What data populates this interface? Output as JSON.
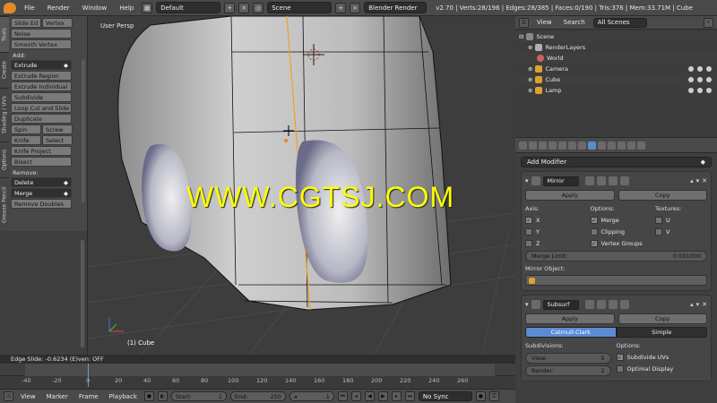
{
  "topbar": {
    "menus": [
      "File",
      "Render",
      "Window",
      "Help"
    ],
    "layout": "Default",
    "scene": "Scene",
    "engine": "Blender Render",
    "stats": "v2.70 | Verts:28/196 | Edges:28/385 | Faces:0/190 | Tris:376 | Mem:33.71M | Cube"
  },
  "tabs": [
    "Tools",
    "Create",
    "Shading / UVs",
    "Options",
    "Grease Pencil"
  ],
  "shelf": {
    "row1": [
      "Slide Ed",
      "Vertex"
    ],
    "noise": "Noise",
    "smooth_vertex": "Smooth Vertex",
    "add_label": "Add:",
    "extrude": "Extrude",
    "extrude_region": "Extrude Region",
    "extrude_individual": "Extrude Individual",
    "subdivide": "Subdivide",
    "loop_cut": "Loop Cut and Slide",
    "duplicate": "Duplicate",
    "spin": "Spin",
    "screw": "Screw",
    "knife": "Knife",
    "select": "Select",
    "knife_project": "Knife Project",
    "bisect": "Bisect",
    "remove_label": "Remove:",
    "delete": "Delete",
    "merge": "Merge",
    "remove_doubles": "Remove Doubles"
  },
  "viewport": {
    "label": "User Persp",
    "object": "(1) Cube",
    "watermark": "WWW.CGTSJ.COM"
  },
  "statusline": "Edge Slide: -0.6234 (E)ven: OFF",
  "timeline": {
    "ticks": [
      "-40",
      "-20",
      "0",
      "20",
      "40",
      "60",
      "80",
      "100",
      "120",
      "140",
      "160",
      "180",
      "200",
      "220",
      "240",
      "260"
    ]
  },
  "bottombar": {
    "menus": [
      "View",
      "Marker",
      "Frame",
      "Playback"
    ],
    "start_label": "Start:",
    "start": "1",
    "end_label": "End:",
    "end": "250",
    "current": "1",
    "sync": "No Sync"
  },
  "outliner": {
    "view": "View",
    "search": "Search",
    "filter": "All Scenes",
    "items": [
      {
        "name": "Scene",
        "color": "#8a8a8a"
      },
      {
        "name": "RenderLayers",
        "color": "#b0b0b0"
      },
      {
        "name": "World",
        "color": "#d06060"
      },
      {
        "name": "Camera",
        "color": "#e0a030"
      },
      {
        "name": "Cube",
        "color": "#e0a030"
      },
      {
        "name": "Lamp",
        "color": "#e0a030"
      }
    ]
  },
  "props": {
    "add_modifier": "Add Modifier",
    "mirror": {
      "name": "Mirror",
      "apply": "Apply",
      "copy": "Copy",
      "axis_title": "Axis:",
      "options_title": "Options:",
      "textures_title": "Textures:",
      "axis": [
        "X",
        "Y",
        "Z"
      ],
      "options": [
        "Merge",
        "Clipping",
        "Vertex Groups"
      ],
      "textures": [
        "U",
        "V"
      ],
      "merge_limit_label": "Merge Limit:",
      "merge_limit": "0.001000",
      "mirror_object_label": "Mirror Object:"
    },
    "subsurf": {
      "name": "Subsurf",
      "apply": "Apply",
      "copy": "Copy",
      "catmull": "Catmull-Clark",
      "simple": "Simple",
      "subdiv_title": "Subdivisions:",
      "options_title": "Options:",
      "view_label": "View:",
      "view": "5",
      "render_label": "Render:",
      "render": "2",
      "subdivide_uvs": "Subdivide UVs",
      "optimal_display": "Optimal Display"
    }
  }
}
